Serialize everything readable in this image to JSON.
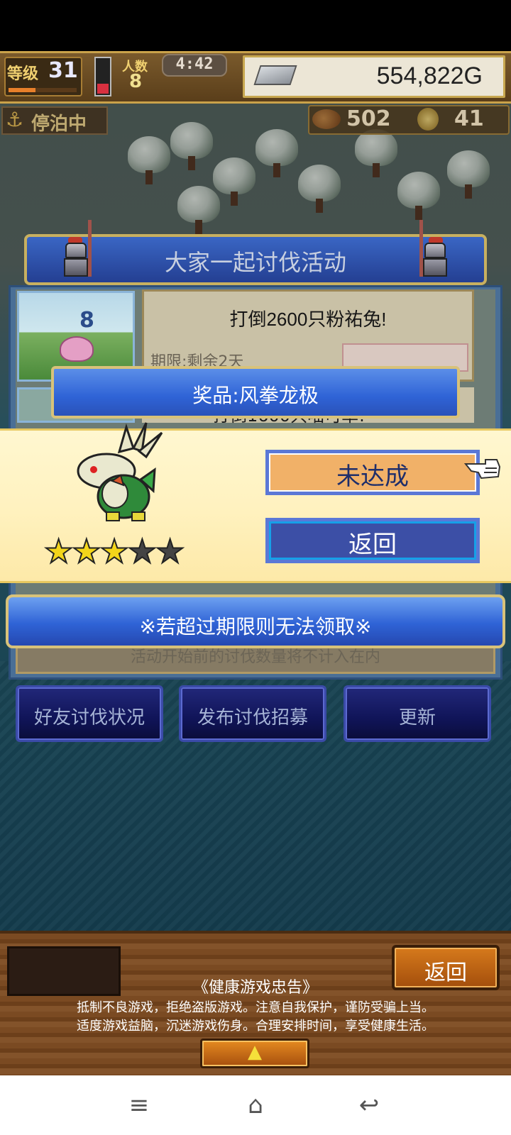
{
  "hud": {
    "level_label": "等级",
    "level_value": "31",
    "crew_label": "人数",
    "crew_value": "8",
    "clock": "4:42",
    "gold": "554,822G",
    "moor_label": "停泊中",
    "meat_value": "502",
    "coin_value": "41"
  },
  "event": {
    "title": "大家一起讨伐活动",
    "mission1_text": "打倒2600只粉祐兔!",
    "mission1_count": "8",
    "mission1_deadline": "期限:剩余2天",
    "mission2_text": "打倒1600只喵可草!",
    "foot_note": "活动开始前的讨伐数量将不计入在内"
  },
  "event_buttons": {
    "friends": "好友讨伐状况",
    "recruit": "发布讨伐招募",
    "refresh": "更新"
  },
  "reward": {
    "prize_title": "奖品:风拳龙极",
    "stars_total": 5,
    "stars_filled": 3,
    "status_label": "未达成",
    "back_label": "返回",
    "notice": "※若超过期限则无法领取※"
  },
  "bottom": {
    "back_label": "返回",
    "health_title": "《健康游戏忠告》",
    "health_line1": "抵制不良游戏，拒绝盗版游戏。注意自我保护，谨防受骗上当。",
    "health_line2": "适度游戏益脑，沉迷游戏伤身。合理安排时间，享受健康生活。"
  },
  "navbar": {
    "menu_icon": "≡",
    "home_icon": "⌂",
    "back_icon": "↩"
  },
  "colors": {
    "banner_blue": "#2f63d6",
    "status_orange": "#f1b168",
    "star_gold": "#f3d51a",
    "wood_brown": "#7a4a22"
  }
}
